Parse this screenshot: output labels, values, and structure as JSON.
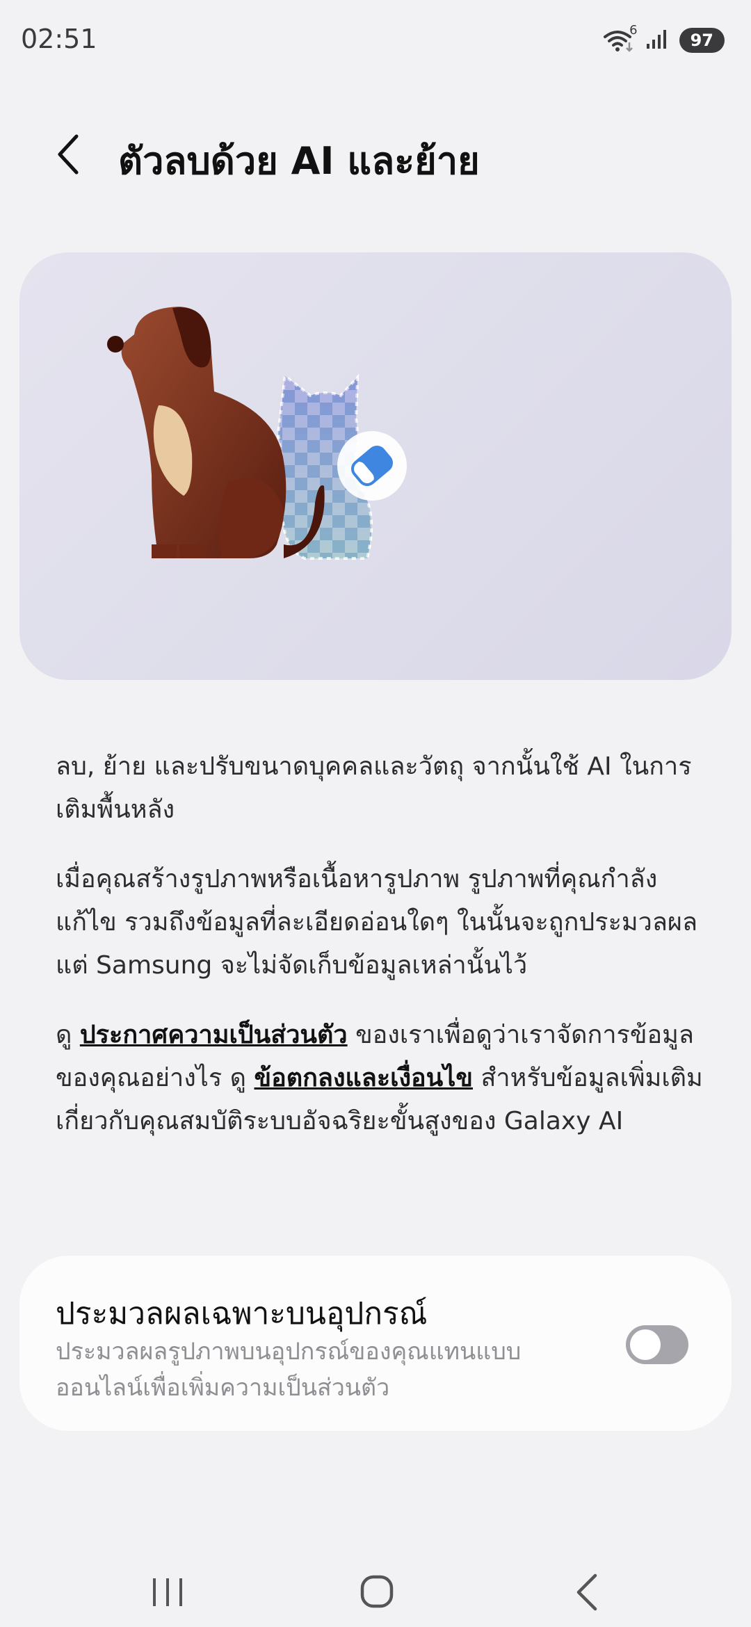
{
  "status_bar": {
    "time": "02:51",
    "wifi_badge": "6",
    "battery": "97",
    "icons": [
      "wifi-icon",
      "signal-icon",
      "battery-icon"
    ]
  },
  "header": {
    "title": "ตัวลบด้วย AI และย้าย",
    "back_icon": "chevron-left-icon"
  },
  "hero": {
    "illustration": "dog-and-erased-cat-illustration",
    "eraser_icon": "eraser-icon",
    "colors": {
      "dog": "#7a2f1c",
      "dog_chest": "#e9c9a0",
      "eraser_badge": "#ffffff",
      "eraser": "#3f86e0"
    }
  },
  "description": {
    "p1": "ลบ, ย้าย และปรับขนาดบุคคลและวัตถุ จากนั้นใช้ AI ในการเติมพื้นหลัง",
    "p2": "เมื่อคุณสร้างรูปภาพหรือเนื้อหารูปภาพ รูปภาพที่คุณกำลังแก้ไข รวมถึงข้อมูลที่ละเอียดอ่อนใดๆ ในนั้นจะถูกประมวลผล แต่ Samsung จะไม่จัดเก็บข้อมูลเหล่านั้นไว้",
    "p3_prefix": "ดู ",
    "privacy_link": "ประกาศความเป็นส่วนตัว",
    "p3_middle": " ของเราเพื่อดูว่าเราจัดการข้อมูลของคุณอย่างไร ดู ",
    "terms_link": "ข้อตกลงและเงื่อนไข",
    "p3_suffix": " สำหรับข้อมูลเพิ่มเติมเกี่ยวกับคุณสมบัติระบบอัจฉริยะขั้นสูงของ Galaxy AI"
  },
  "on_device": {
    "title": "ประมวลผลเฉพาะบนอุปกรณ์",
    "subtitle": "ประมวลผลรูปภาพบนอุปกรณ์ของคุณแทนแบบออนไลน์เพื่อเพิ่มความเป็นส่วนตัว",
    "enabled": false
  },
  "nav_bar": {
    "icons": [
      "recent-apps-icon",
      "home-icon",
      "back-icon"
    ]
  }
}
